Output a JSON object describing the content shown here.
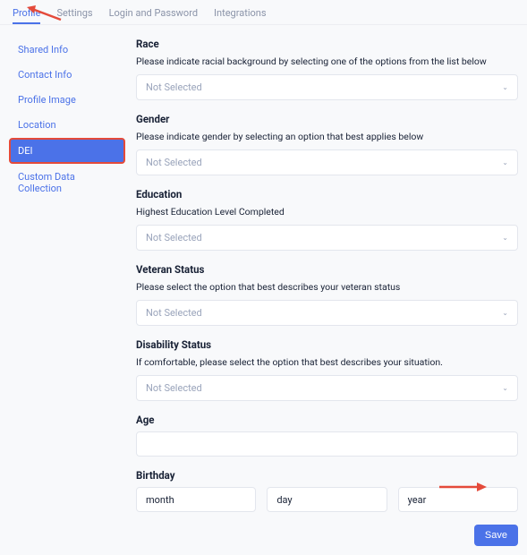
{
  "topTabs": [
    {
      "label": "Profile",
      "active": true
    },
    {
      "label": "Settings",
      "active": false
    },
    {
      "label": "Login and Password",
      "active": false
    },
    {
      "label": "Integrations",
      "active": false
    }
  ],
  "sidebar": [
    {
      "label": "Shared Info",
      "active": false
    },
    {
      "label": "Contact Info",
      "active": false
    },
    {
      "label": "Profile Image",
      "active": false
    },
    {
      "label": "Location",
      "active": false
    },
    {
      "label": "DEI",
      "active": true
    },
    {
      "label": "Custom Data Collection",
      "active": false
    }
  ],
  "sections": {
    "race": {
      "title": "Race",
      "desc": "Please indicate racial background by selecting one of the options from the list below",
      "placeholder": "Not Selected"
    },
    "gender": {
      "title": "Gender",
      "desc": "Please indicate gender by selecting an option that best applies below",
      "placeholder": "Not Selected"
    },
    "education": {
      "title": "Education",
      "desc": "Highest Education Level Completed",
      "placeholder": "Not Selected"
    },
    "veteran": {
      "title": "Veteran Status",
      "desc": "Please select the option that best describes your veteran status",
      "placeholder": "Not Selected"
    },
    "disability": {
      "title": "Disability Status",
      "desc": "If comfortable, please select the option that best describes your situation.",
      "placeholder": "Not Selected"
    },
    "age": {
      "title": "Age"
    },
    "birthday": {
      "title": "Birthday",
      "month": "month",
      "day": "day",
      "year": "year"
    }
  },
  "saveLabel": "Save"
}
